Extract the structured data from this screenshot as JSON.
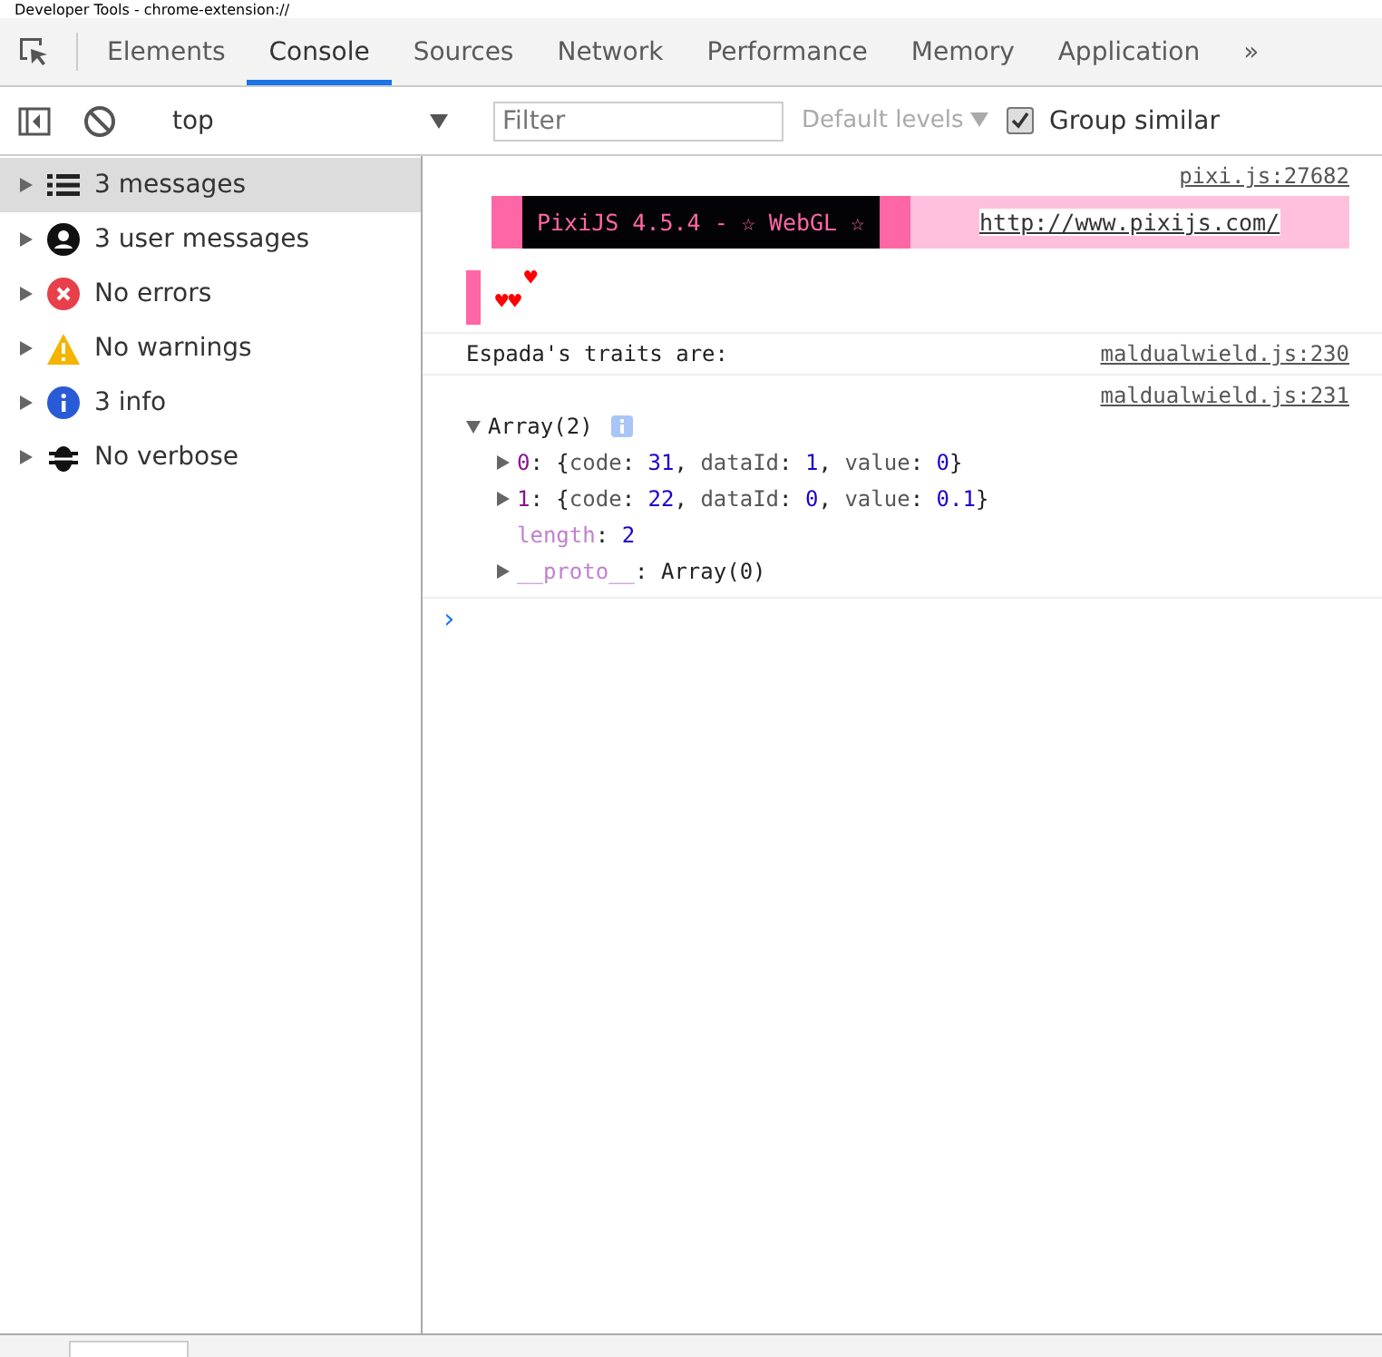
{
  "window": {
    "title": "Developer Tools - chrome-extension://"
  },
  "tabs": [
    {
      "label": "Elements",
      "selected": false
    },
    {
      "label": "Console",
      "selected": true
    },
    {
      "label": "Sources",
      "selected": false
    },
    {
      "label": "Network",
      "selected": false
    },
    {
      "label": "Performance",
      "selected": false
    },
    {
      "label": "Memory",
      "selected": false
    },
    {
      "label": "Application",
      "selected": false
    }
  ],
  "overflow": "»",
  "toolbar": {
    "context": "top",
    "filter": {
      "placeholder": "Filter"
    },
    "levels": "Default levels",
    "group_similar": {
      "label": "Group similar",
      "checked": true
    }
  },
  "sidebar": {
    "items": [
      {
        "kind": "messages",
        "label": "3 messages",
        "selected": true
      },
      {
        "kind": "user",
        "label": "3 user messages",
        "selected": false
      },
      {
        "kind": "error",
        "label": "No errors",
        "selected": false
      },
      {
        "kind": "warning",
        "label": "No warnings",
        "selected": false
      },
      {
        "kind": "info",
        "label": "3 info",
        "selected": false
      },
      {
        "kind": "verbose",
        "label": "No verbose",
        "selected": false
      }
    ]
  },
  "console": {
    "messages": [
      {
        "kind": "pixi",
        "source": "pixi.js:27682",
        "banner": "PixiJS 4.5.4 - ☆ WebGL ☆",
        "url": "http://www.pixijs.com/",
        "heart_top": "♥",
        "heart_bottom": "♥♥"
      },
      {
        "kind": "text",
        "source": "maldualwield.js:230",
        "text": "Espada's traits are:"
      },
      {
        "kind": "object",
        "source": "maldualwield.js:231",
        "header": "Array(2)",
        "expanded": true,
        "entries": [
          {
            "kind": "object",
            "expanded": false,
            "tokens": [
              {
                "kind": "index",
                "text": "0"
              },
              {
                "kind": "punct",
                "text": ": {"
              },
              {
                "kind": "name",
                "text": "code"
              },
              {
                "kind": "punct",
                "text": ": "
              },
              {
                "kind": "number",
                "text": "31"
              },
              {
                "kind": "punct",
                "text": ", "
              },
              {
                "kind": "name",
                "text": "dataId"
              },
              {
                "kind": "punct",
                "text": ": "
              },
              {
                "kind": "number",
                "text": "1"
              },
              {
                "kind": "punct",
                "text": ", "
              },
              {
                "kind": "name",
                "text": "value"
              },
              {
                "kind": "punct",
                "text": ": "
              },
              {
                "kind": "number",
                "text": "0"
              },
              {
                "kind": "punct",
                "text": "}"
              }
            ]
          },
          {
            "kind": "object",
            "expanded": false,
            "tokens": [
              {
                "kind": "index",
                "text": "1"
              },
              {
                "kind": "punct",
                "text": ": {"
              },
              {
                "kind": "name",
                "text": "code"
              },
              {
                "kind": "punct",
                "text": ": "
              },
              {
                "kind": "number",
                "text": "22"
              },
              {
                "kind": "punct",
                "text": ", "
              },
              {
                "kind": "name",
                "text": "dataId"
              },
              {
                "kind": "punct",
                "text": ": "
              },
              {
                "kind": "number",
                "text": "0"
              },
              {
                "kind": "punct",
                "text": ", "
              },
              {
                "kind": "name",
                "text": "value"
              },
              {
                "kind": "punct",
                "text": ": "
              },
              {
                "kind": "number",
                "text": "0.1"
              },
              {
                "kind": "punct",
                "text": "}"
              }
            ]
          },
          {
            "kind": "prop",
            "tokens": [
              {
                "kind": "internal",
                "text": "length"
              },
              {
                "kind": "punct",
                "text": ": "
              },
              {
                "kind": "number",
                "text": "2"
              }
            ]
          },
          {
            "kind": "proto",
            "expanded": false,
            "tokens": [
              {
                "kind": "internal",
                "text": "__proto__"
              },
              {
                "kind": "punct",
                "text": ": Array(0)"
              }
            ]
          }
        ]
      }
    ],
    "prompt": "›"
  }
}
